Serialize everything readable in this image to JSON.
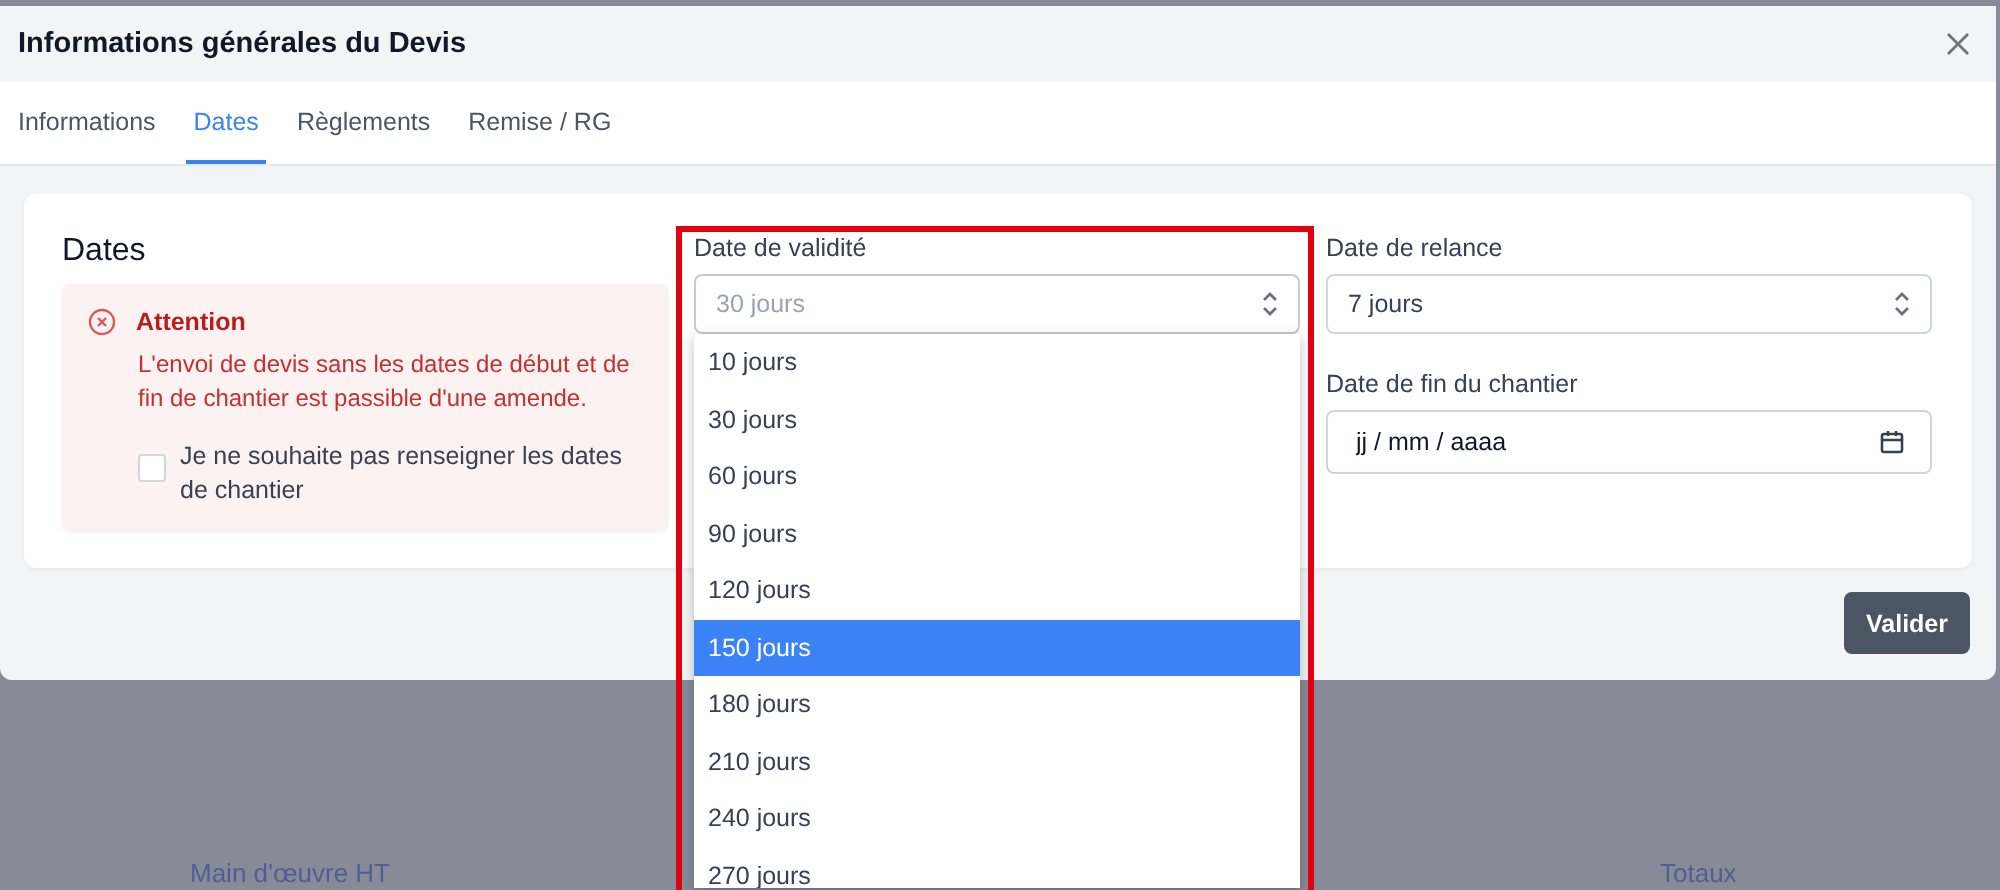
{
  "window": {
    "title": "Informations générales du Devis"
  },
  "tabs": [
    {
      "label": "Informations",
      "selected": false
    },
    {
      "label": "Dates",
      "selected": true
    },
    {
      "label": "Règlements",
      "selected": false
    },
    {
      "label": "Remise / RG",
      "selected": false
    }
  ],
  "section": {
    "title": "Dates",
    "alert": {
      "title": "Attention",
      "message": "L'envoi de devis sans les dates de début et de fin de chantier est passible d'une amende.",
      "checkbox": {
        "label": "Je ne souhaite pas renseigner les dates de chantier",
        "checked": false
      }
    }
  },
  "validity": {
    "label": "Date de validité",
    "placeholder": "30 jours",
    "expanded": true,
    "options": [
      {
        "label": "10 jours",
        "selected": false
      },
      {
        "label": "30 jours",
        "selected": false
      },
      {
        "label": "60 jours",
        "selected": false
      },
      {
        "label": "90 jours",
        "selected": false
      },
      {
        "label": "120 jours",
        "selected": false
      },
      {
        "label": "150 jours",
        "selected": true
      },
      {
        "label": "180 jours",
        "selected": false
      },
      {
        "label": "210 jours",
        "selected": false
      },
      {
        "label": "240 jours",
        "selected": false
      },
      {
        "label": "270 jours",
        "selected": false
      }
    ]
  },
  "reminder": {
    "label": "Date de relance",
    "value": "7 jours"
  },
  "end_date": {
    "label": "Date de fin du chantier",
    "placeholder": "jj / mm / aaaa"
  },
  "buttons": [
    {
      "label": "Valider"
    }
  ],
  "background": {
    "columns": [
      "Main d'œuvre HT",
      "Totaux"
    ]
  }
}
